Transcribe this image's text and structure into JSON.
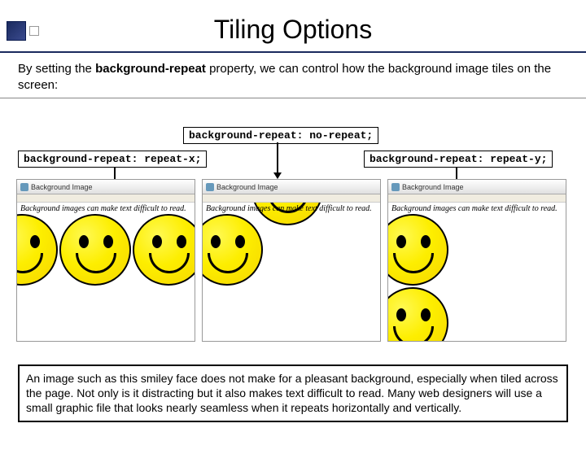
{
  "title": "Tiling Options",
  "intro": {
    "pre": "By setting the ",
    "bold": "background-repeat",
    "post": " property, we can control how the background image tiles on the screen:"
  },
  "code": {
    "no_repeat": "background-repeat: no-repeat;",
    "repeat_x": "background-repeat: repeat-x;",
    "repeat_y": "background-repeat: repeat-y;"
  },
  "examples": {
    "header_label": "Background Image",
    "caption_x": "Background images can make text difficult to read.",
    "caption_none": "Background images can make text difficult to read.",
    "caption_y": "Background images can make text difficult to read."
  },
  "footer": "An image such as this smiley face does not make for a pleasant background, especially when tiled across the page.  Not only is it distracting but it also makes text difficult to read.  Many web designers will use a small graphic file that looks nearly seamless when it repeats horizontally and vertically."
}
